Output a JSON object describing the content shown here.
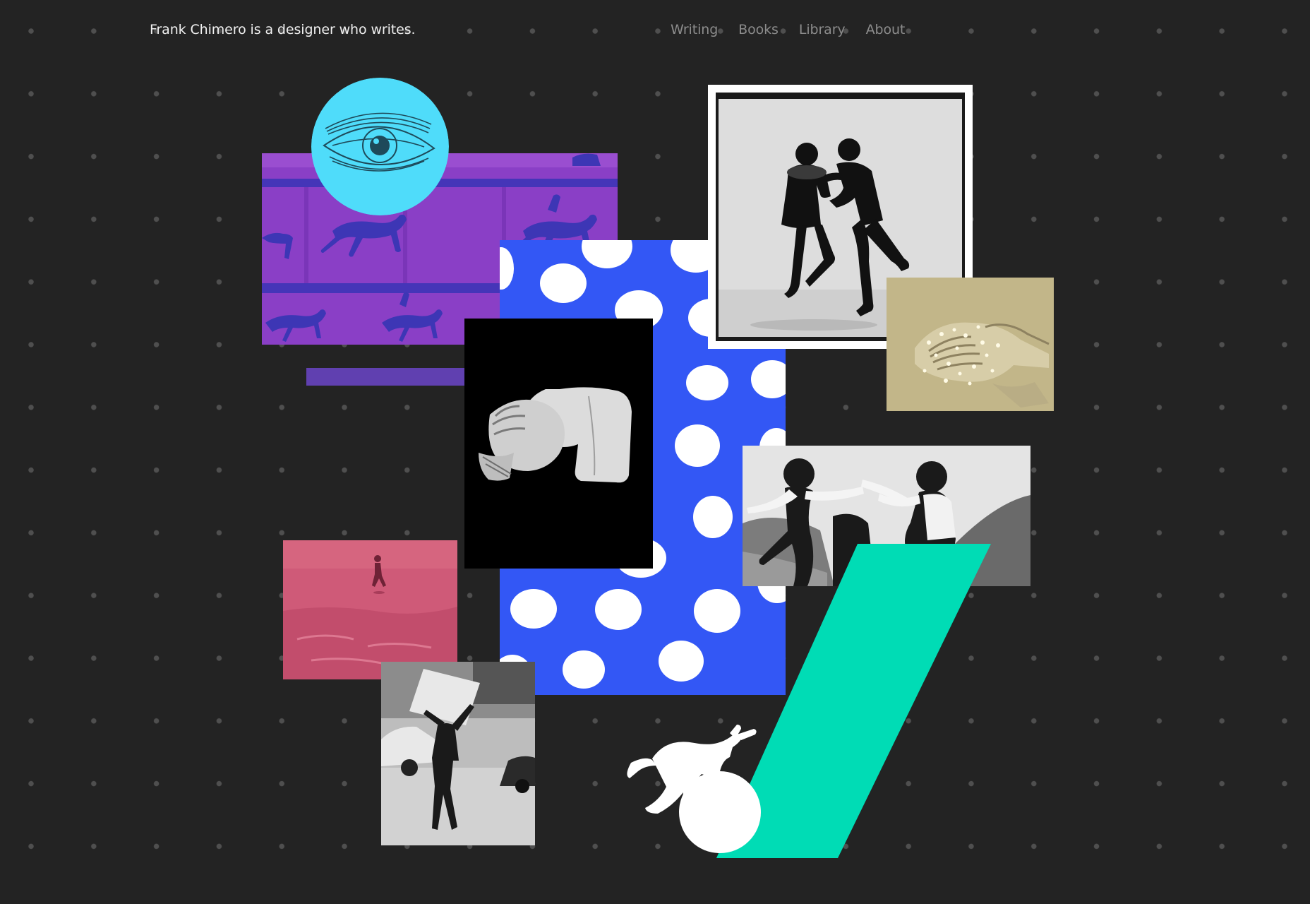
{
  "site": {
    "tagline": "Frank Chimero is a designer who writes."
  },
  "nav": {
    "items": [
      {
        "label": "Writing"
      },
      {
        "label": "Books"
      },
      {
        "label": "Library"
      },
      {
        "label": "About"
      }
    ]
  },
  "colors": {
    "background": "#232323",
    "dot": "#4f4f4f",
    "purple": "#8a3fc6",
    "cyan": "#4fdcfa",
    "blue": "#3357f5",
    "mint": "#00dcb5",
    "indigo_bar": "#6040b0",
    "pink": "#cf5a78",
    "sepia": "#c9bd93"
  },
  "collage": {
    "images": [
      {
        "name": "muybridge-horses-image"
      },
      {
        "name": "engraved-eye-image"
      },
      {
        "name": "blue-polka-dot-panel"
      },
      {
        "name": "marble-bust-image"
      },
      {
        "name": "dancing-couple-photo"
      },
      {
        "name": "clapping-hands-image"
      },
      {
        "name": "martial-arts-photo"
      },
      {
        "name": "pink-beach-runner-image"
      },
      {
        "name": "street-performer-photo"
      },
      {
        "name": "white-figure-cutout"
      }
    ]
  }
}
